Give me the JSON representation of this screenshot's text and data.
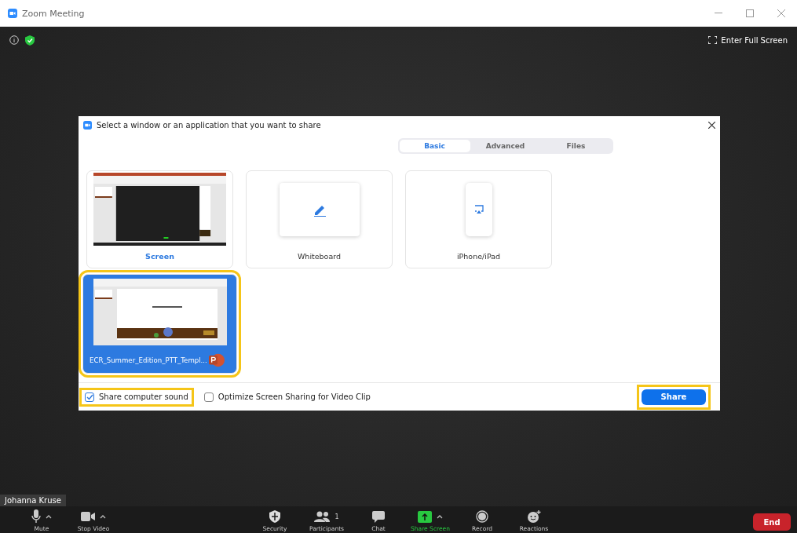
{
  "window": {
    "title": "Zoom Meeting"
  },
  "meeting": {
    "fullscreen_label": "Enter Full Screen",
    "participant_name": "Johanna Kruse"
  },
  "dialog": {
    "title": "Select a window or an application that you want to share",
    "tabs": [
      {
        "label": "Basic",
        "selected": true
      },
      {
        "label": "Advanced",
        "selected": false
      },
      {
        "label": "Files",
        "selected": false
      }
    ],
    "sources": [
      {
        "kind": "screen",
        "label": "Screen",
        "selected": false,
        "highlighted": false
      },
      {
        "kind": "whiteboard",
        "label": "Whiteboard",
        "selected": false,
        "highlighted": false
      },
      {
        "kind": "phone",
        "label": "iPhone/iPad",
        "selected": false,
        "highlighted": false
      },
      {
        "kind": "window",
        "label": "ECR_Summer_Edition_PTT_Templ...",
        "selected": true,
        "highlighted": true
      }
    ],
    "options": [
      {
        "label": "Share computer sound",
        "checked": true,
        "highlighted": true
      },
      {
        "label": "Optimize Screen Sharing for Video Clip",
        "checked": false,
        "highlighted": false
      }
    ],
    "share_button": {
      "label": "Share",
      "highlighted": true
    }
  },
  "toolbar": {
    "items": [
      {
        "kind": "mic",
        "label": "Mute",
        "caret": true,
        "active": false
      },
      {
        "kind": "video",
        "label": "Stop Video",
        "caret": true,
        "active": false
      },
      {
        "kind": "security",
        "label": "Security",
        "caret": false,
        "active": false
      },
      {
        "kind": "participants",
        "label": "Participants",
        "count": "1",
        "caret": false,
        "active": false
      },
      {
        "kind": "chat",
        "label": "Chat",
        "caret": false,
        "active": false
      },
      {
        "kind": "share",
        "label": "Share Screen",
        "caret": true,
        "active": true
      },
      {
        "kind": "record",
        "label": "Record",
        "caret": false,
        "active": false
      },
      {
        "kind": "reactions",
        "label": "Reactions",
        "caret": false,
        "active": false
      }
    ],
    "end_button": "End"
  }
}
